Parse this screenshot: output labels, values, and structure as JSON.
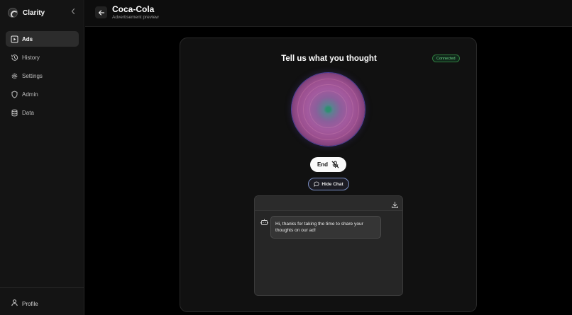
{
  "app": {
    "name": "Clarity"
  },
  "sidebar": {
    "items": [
      {
        "label": "Ads",
        "icon": "play-square-icon",
        "active": true
      },
      {
        "label": "History",
        "icon": "history-icon",
        "active": false
      },
      {
        "label": "Settings",
        "icon": "gear-icon",
        "active": false
      },
      {
        "label": "Admin",
        "icon": "shield-icon",
        "active": false
      },
      {
        "label": "Data",
        "icon": "database-icon",
        "active": false
      }
    ],
    "profile_label": "Profile"
  },
  "header": {
    "title": "Coca-Cola",
    "subtitle": "Advertisement preview"
  },
  "main": {
    "title": "Tell us what you thought",
    "status": "Connected",
    "end_label": "End",
    "hide_chat_label": "Hide Chat",
    "chat": {
      "messages": [
        {
          "role": "assistant",
          "text": "Hi, thanks for taking the time to share your thoughts on our ad!"
        }
      ]
    }
  },
  "colors": {
    "accent_ring": "#7b8fc4",
    "status_green": "#6fd58a",
    "orb_core": "#2e8f70"
  }
}
